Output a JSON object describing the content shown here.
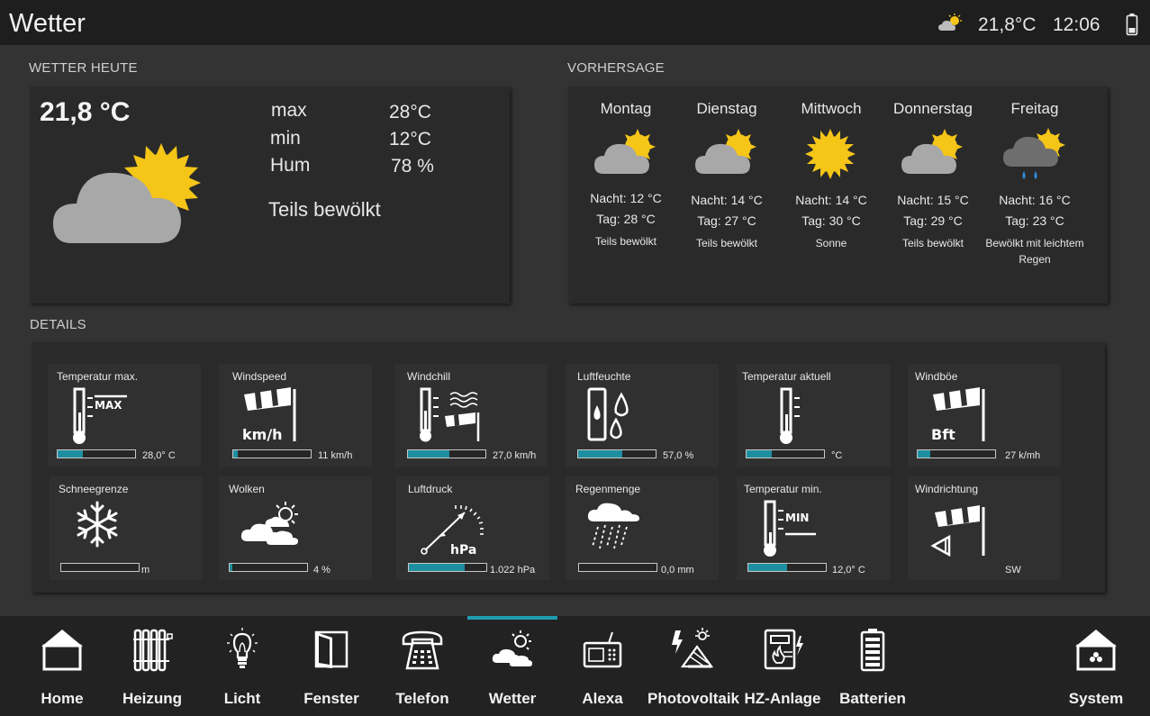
{
  "header": {
    "title": "Wetter",
    "temperature": "21,8°C",
    "time": "12:06",
    "weather_icon": "partly-cloudy-icon",
    "battery_icon": "battery-icon"
  },
  "sections": {
    "today": "WETTER HEUTE",
    "forecast": "VORHERSAGE",
    "details": "DETAILS"
  },
  "today": {
    "temperature": "21,8 °C",
    "rows": [
      {
        "label": "max",
        "value": "28°C"
      },
      {
        "label": "min",
        "value": "12°C"
      },
      {
        "label": "Hum",
        "value": "78 %"
      }
    ],
    "description": "Teils bewölkt",
    "icon": "partly-cloudy-icon"
  },
  "forecast": [
    {
      "day": "Montag",
      "night": "Nacht: 12 °C",
      "day_temp": "Tag: 28 °C",
      "desc": "Teils bewölkt",
      "icon": "partly-cloudy-icon"
    },
    {
      "day": "Dienstag",
      "night": "Nacht: 14 °C",
      "day_temp": "Tag: 27 °C",
      "desc": "Teils bewölkt",
      "icon": "partly-cloudy-icon"
    },
    {
      "day": "Mittwoch",
      "night": "Nacht: 14 °C",
      "day_temp": "Tag: 30 °C",
      "desc": "Sonne",
      "icon": "sun-icon"
    },
    {
      "day": "Donnerstag",
      "night": "Nacht: 15 °C",
      "day_temp": "Tag: 29 °C",
      "desc": "Teils bewölkt",
      "icon": "partly-cloudy-icon"
    },
    {
      "day": "Freitag",
      "night": "Nacht: 16 °C",
      "day_temp": "Tag: 23 °C",
      "desc": "Bewölkt mit leichtem Regen",
      "icon": "light-rain-icon"
    }
  ],
  "details": [
    {
      "title": "Temperatur max.",
      "value": "28,0° C",
      "progress": 0.32,
      "icon": "thermometer-max-icon"
    },
    {
      "title": "Windspeed",
      "value": "11 km/h",
      "progress": 0.06,
      "icon": "windsock-kmh-icon"
    },
    {
      "title": "Windchill",
      "value": "27,0 km/h",
      "progress": 0.53,
      "icon": "windchill-icon"
    },
    {
      "title": "Luftfeuchte",
      "value": "57,0 %",
      "progress": 0.57,
      "icon": "humidity-icon"
    },
    {
      "title": "Temperatur aktuell",
      "value": "°C",
      "progress": 0.32,
      "icon": "thermometer-icon"
    },
    {
      "title": "Windböe",
      "value": "27 k/mh",
      "progress": 0.16,
      "icon": "windsock-bft-icon"
    },
    {
      "title": "Schneegrenze",
      "value": "m",
      "progress": 0.0,
      "icon": "snowflake-icon"
    },
    {
      "title": "Wolken",
      "value": "4 %",
      "progress": 0.04,
      "icon": "clouds-icon"
    },
    {
      "title": "Luftdruck",
      "value": "1.022 hPa",
      "progress": 0.72,
      "icon": "barometer-icon"
    },
    {
      "title": "Regenmenge",
      "value": "0,0 mm",
      "progress": 0.0,
      "icon": "rain-amount-icon"
    },
    {
      "title": "Temperatur min.",
      "value": "12,0° C",
      "progress": 0.5,
      "icon": "thermometer-min-icon"
    },
    {
      "title": "Windrichtung",
      "value": "SW",
      "progress": null,
      "icon": "wind-direction-icon"
    }
  ],
  "nav": [
    {
      "label": "Home",
      "icon": "house-icon"
    },
    {
      "label": "Heizung",
      "icon": "radiator-icon"
    },
    {
      "label": "Licht",
      "icon": "bulb-icon"
    },
    {
      "label": "Fenster",
      "icon": "window-icon"
    },
    {
      "label": "Telefon",
      "icon": "phone-icon"
    },
    {
      "label": "Wetter",
      "icon": "weather-icon",
      "active": true
    },
    {
      "label": "Alexa",
      "icon": "radio-icon"
    },
    {
      "label": "Photovoltaik",
      "icon": "solar-panel-icon"
    },
    {
      "label": "HZ-Anlage",
      "icon": "boiler-icon"
    },
    {
      "label": "Batterien",
      "icon": "battery-icon"
    },
    {
      "label": "System",
      "icon": "system-house-icon"
    }
  ],
  "colors": {
    "accent": "#1e9db0",
    "bar_fill": "#1e8fa0",
    "sun": "#f5c518",
    "cloud": "#a6a6a6",
    "rain": "#2f8ee0"
  }
}
